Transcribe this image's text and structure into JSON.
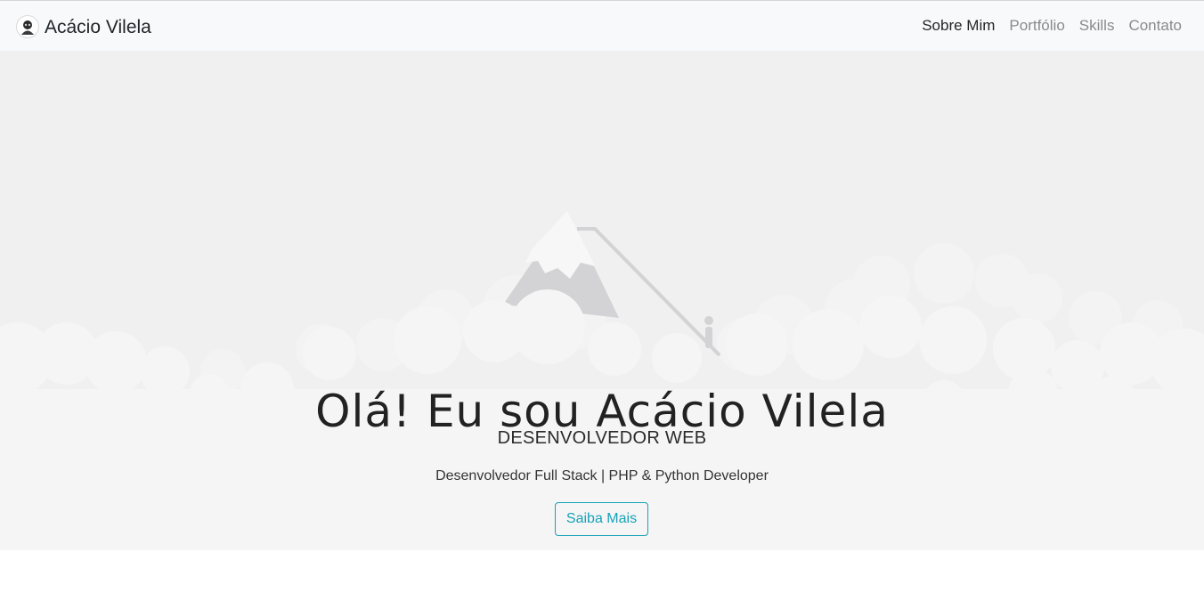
{
  "brand": {
    "name": "Acácio Vilela",
    "avatar_icon": "avatar-icon"
  },
  "nav": {
    "items": [
      {
        "label": "Sobre Mim",
        "active": true
      },
      {
        "label": "Portfólio",
        "active": false
      },
      {
        "label": "Skills",
        "active": false
      },
      {
        "label": "Contato",
        "active": false
      }
    ]
  },
  "hero": {
    "title": "Olá! Eu sou Acácio Vilela",
    "role": "DESENVOLVEDOR WEB",
    "description": "Desenvolvedor Full Stack | PHP & Python Developer",
    "button_label": "Saiba Mais",
    "illustration": "mountain-clouds-illustration"
  },
  "colors": {
    "accent": "#17a2b8",
    "navbar_bg": "#f8f9fa",
    "hero_bg": "#f0f0f0",
    "cloud": "#f5f5f5",
    "mountain": "#d3d2d4",
    "nav_active": "#212529",
    "nav_inactive": "#8a8a8a"
  }
}
